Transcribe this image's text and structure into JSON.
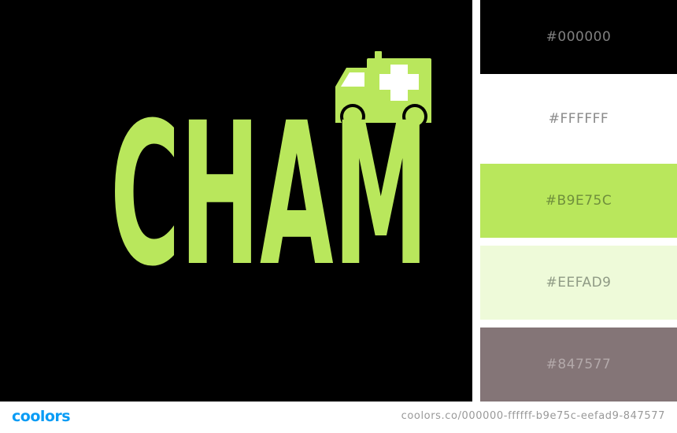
{
  "artwork": {
    "logo_text": "CHAM",
    "logo_color": "#B9E75C",
    "background_color": "#000000",
    "icon": "ambulance-icon"
  },
  "palette": {
    "swatches": [
      {
        "hex": "#000000",
        "label": "#000000",
        "text_color": "#808080"
      },
      {
        "hex": "#FFFFFF",
        "label": "#FFFFFF",
        "text_color": "#8a8a8a"
      },
      {
        "hex": "#B9E75C",
        "label": "#B9E75C",
        "text_color": "#6f8f3c"
      },
      {
        "hex": "#EEFAD9",
        "label": "#EEFAD9",
        "text_color": "#8f9a85"
      },
      {
        "hex": "#847577",
        "label": "#847577",
        "text_color": "#b3a9aa"
      }
    ]
  },
  "footer": {
    "brand": "coolors",
    "brand_color": "#0A9CF5",
    "url": "coolors.co/000000-ffffff-b9e75c-eefad9-847577"
  }
}
